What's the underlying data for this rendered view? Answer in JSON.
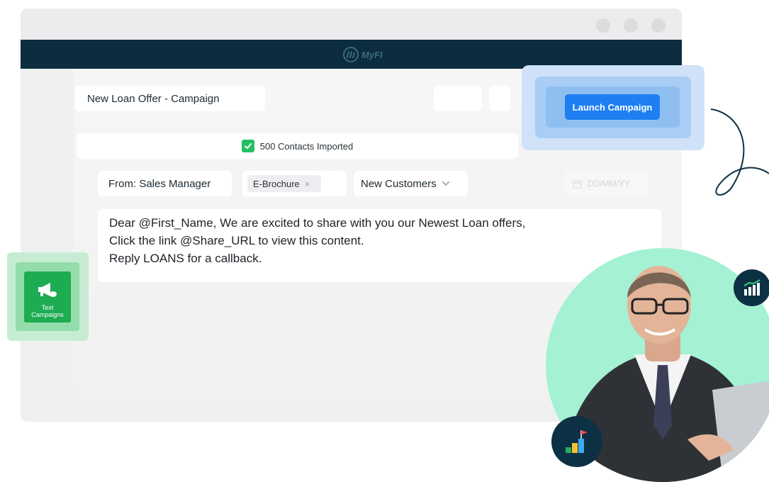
{
  "app": {
    "logo_text": "MyFI"
  },
  "campaign": {
    "name": "New Loan Offer - Campaign"
  },
  "toolbar": {
    "launch_label": "Launch Campaign"
  },
  "status": {
    "imported_text": "500 Contacts Imported"
  },
  "form": {
    "from_text": "From: Sales Manager",
    "tag_label": "E-Brochure",
    "tag_remove": "×",
    "audience_value": "New Customers",
    "date_placeholder": "DD/MM/YY"
  },
  "message": {
    "lines": [
      "Dear @First_Name, We are excited to share with you our Newest Loan offers,",
      "Click the link @Share_URL to view this content.",
      "Reply LOANS for a callback."
    ]
  },
  "sidebar": {
    "text_campaigns_line1": "Text",
    "text_campaigns_line2": "Campaigns"
  },
  "colors": {
    "navbar": "#0c2d3d",
    "accent_blue": "#1d7ff2",
    "accent_green": "#1dac51",
    "mint": "#a4f2d3",
    "badge": "#0d3144"
  },
  "icons": {
    "logo": "myfi-logo-icon",
    "check": "check-icon",
    "tag_remove": "close-icon",
    "dropdown": "chevron-down-icon",
    "calendar": "calendar-icon",
    "megaphone": "megaphone-icon",
    "growth": "growth-chart-icon",
    "goal": "goal-bars-flag-icon"
  }
}
